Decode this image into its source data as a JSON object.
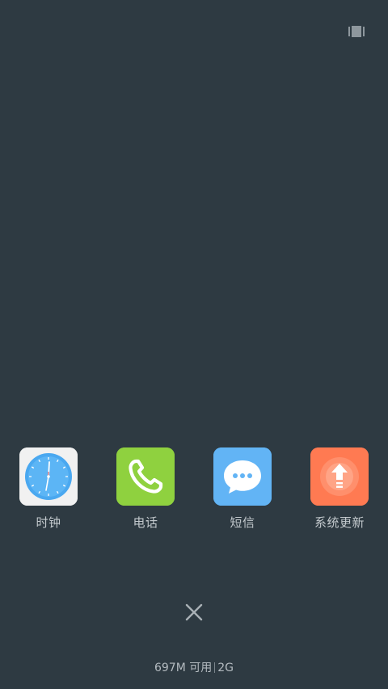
{
  "header": {
    "view_toggle_icon": "card-view-icon"
  },
  "apps": [
    {
      "label": "时钟",
      "icon": "clock-icon",
      "tile_color": "#f2f2f2",
      "accent": "#4aa8f0"
    },
    {
      "label": "电话",
      "icon": "phone-icon",
      "tile_color": "#8fd13f",
      "accent": "#ffffff"
    },
    {
      "label": "短信",
      "icon": "message-icon",
      "tile_color": "#62b4f5",
      "accent": "#ffffff"
    },
    {
      "label": "系统更新",
      "icon": "system-update-icon",
      "tile_color": "#ff7a52",
      "accent": "#ffffff"
    }
  ],
  "footer": {
    "close_icon": "close-icon",
    "memory_available": "697M 可用",
    "memory_total": "2G"
  },
  "colors": {
    "background": "#2e3a42",
    "text": "#c3c9cd"
  }
}
